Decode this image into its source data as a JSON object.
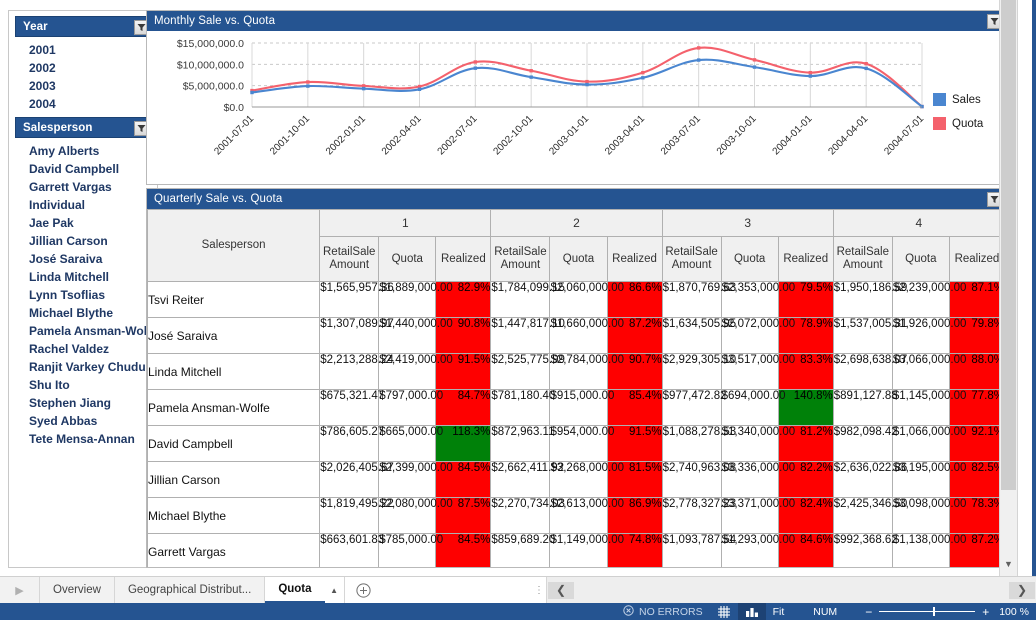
{
  "sidebar": {
    "year_slicer": {
      "title": "Year",
      "filter_icon": "funnel-icon",
      "items": [
        "2001",
        "2002",
        "2003",
        "2004"
      ]
    },
    "salesperson_slicer": {
      "title": "Salesperson",
      "filter_icon": "funnel-icon",
      "items": [
        "Amy Alberts",
        "David Campbell",
        "Garrett Vargas",
        "Individual",
        "Jae Pak",
        "Jillian Carson",
        "José Saraiva",
        "Linda Mitchell",
        "Lynn Tsoflias",
        "Michael Blythe",
        "Pamela Ansman-Wolfe",
        "Rachel Valdez",
        "Ranjit Varkey Chudukatil",
        "Shu Ito",
        "Stephen Jiang",
        "Syed Abbas",
        "Tete Mensa-Annan"
      ]
    }
  },
  "chart_panel": {
    "title": "Monthly Sale vs. Quota",
    "filter_icon": "funnel-icon"
  },
  "chart_data": {
    "type": "line",
    "title": "Monthly Sale vs. Quota",
    "xlabel": "",
    "ylabel": "",
    "ylim": [
      0,
      15000000
    ],
    "grid": true,
    "legend_position": "right",
    "ytick_labels": [
      "$15,000,000.0",
      "$10,000,000.0",
      "$5,000,000.0",
      "$0.0"
    ],
    "ytick_values": [
      15000000,
      10000000,
      5000000,
      0
    ],
    "categories": [
      "2001-07-01",
      "2001-10-01",
      "2002-01-01",
      "2002-04-01",
      "2002-07-01",
      "2002-10-01",
      "2003-01-01",
      "2003-04-01",
      "2003-07-01",
      "2003-10-01",
      "2004-01-01",
      "2004-04-01",
      "2004-07-01"
    ],
    "series": [
      {
        "name": "Sales",
        "color": "#4a86d0",
        "values": [
          3400000,
          4900000,
          4300000,
          4150000,
          9100000,
          7000000,
          5250000,
          6850000,
          11000000,
          9350000,
          7250000,
          9050000,
          100000
        ]
      },
      {
        "name": "Quota",
        "color": "#f4616c",
        "values": [
          3850000,
          5850000,
          4950000,
          4800000,
          10550000,
          8500000,
          5950000,
          8050000,
          13850000,
          11050000,
          8050000,
          10150000,
          100000
        ]
      }
    ]
  },
  "table_panel": {
    "title": "Quarterly Sale vs. Quota",
    "filter_icon": "funnel-icon",
    "row_header": "Salesperson",
    "quarters": [
      "1",
      "2",
      "3",
      "4"
    ],
    "sub_headers": [
      "RetailSale Amount",
      "Quota",
      "Realized"
    ],
    "sub_header_lines": [
      [
        "RetailSale",
        "Amount"
      ],
      [
        "Quota",
        ""
      ],
      [
        "Realized",
        ""
      ]
    ],
    "colors": {
      "bad": "#fe0000",
      "good": "#008109"
    },
    "rows": [
      {
        "name": "Tsvi Reiter",
        "cells": [
          {
            "amount": "$1,565,957.36",
            "quota": "$1,889,000.00",
            "realized": "82.9%",
            "state": "bad"
          },
          {
            "amount": "$1,784,099.15",
            "quota": "$2,060,000.00",
            "realized": "86.6%",
            "state": "bad"
          },
          {
            "amount": "$1,870,769.63",
            "quota": "$2,353,000.00",
            "realized": "79.5%",
            "state": "bad"
          },
          {
            "amount": "$1,950,186.59",
            "quota": "$2,239,000.00",
            "realized": "87.1%",
            "state": "bad"
          }
        ]
      },
      {
        "name": "José Saraiva",
        "cells": [
          {
            "amount": "$1,307,089.97",
            "quota": "$1,440,000.00",
            "realized": "90.8%",
            "state": "bad"
          },
          {
            "amount": "$1,447,817.10",
            "quota": "$1,660,000.00",
            "realized": "87.2%",
            "state": "bad"
          },
          {
            "amount": "$1,634,505.95",
            "quota": "$2,072,000.00",
            "realized": "78.9%",
            "state": "bad"
          },
          {
            "amount": "$1,537,005.31",
            "quota": "$1,926,000.00",
            "realized": "79.8%",
            "state": "bad"
          }
        ]
      },
      {
        "name": "Linda Mitchell",
        "cells": [
          {
            "amount": "$2,213,288.24",
            "quota": "$2,419,000.00",
            "realized": "91.5%",
            "state": "bad"
          },
          {
            "amount": "$2,525,775.99",
            "quota": "$2,784,000.00",
            "realized": "90.7%",
            "state": "bad"
          },
          {
            "amount": "$2,929,305.10",
            "quota": "$3,517,000.00",
            "realized": "83.3%",
            "state": "bad"
          },
          {
            "amount": "$2,698,638.07",
            "quota": "$3,066,000.00",
            "realized": "88.0%",
            "state": "bad"
          }
        ]
      },
      {
        "name": "Pamela Ansman-Wolfe",
        "cells": [
          {
            "amount": "$675,321.47",
            "quota": "$797,000.00",
            "realized": "84.7%",
            "state": "bad"
          },
          {
            "amount": "$781,180.40",
            "quota": "$915,000.00",
            "realized": "85.4%",
            "state": "bad"
          },
          {
            "amount": "$977,472.82",
            "quota": "$694,000.00",
            "realized": "140.8%",
            "state": "good"
          },
          {
            "amount": "$891,127.88",
            "quota": "$1,145,000.00",
            "realized": "77.8%",
            "state": "bad"
          }
        ]
      },
      {
        "name": "David Campbell",
        "cells": [
          {
            "amount": "$786,605.27",
            "quota": "$665,000.00",
            "realized": "118.3%",
            "state": "good"
          },
          {
            "amount": "$872,963.11",
            "quota": "$954,000.00",
            "realized": "91.5%",
            "state": "bad"
          },
          {
            "amount": "$1,088,278.53",
            "quota": "$1,340,000.00",
            "realized": "81.2%",
            "state": "bad"
          },
          {
            "amount": "$982,098.42",
            "quota": "$1,066,000.00",
            "realized": "92.1%",
            "state": "bad"
          }
        ]
      },
      {
        "name": "Jillian Carson",
        "cells": [
          {
            "amount": "$2,026,405.67",
            "quota": "$2,399,000.00",
            "realized": "84.5%",
            "state": "bad"
          },
          {
            "amount": "$2,662,411.92",
            "quota": "$3,268,000.00",
            "realized": "81.5%",
            "state": "bad"
          },
          {
            "amount": "$2,740,963.08",
            "quota": "$3,336,000.00",
            "realized": "82.2%",
            "state": "bad"
          },
          {
            "amount": "$2,636,022.86",
            "quota": "$3,195,000.00",
            "realized": "82.5%",
            "state": "bad"
          }
        ]
      },
      {
        "name": "Michael Blythe",
        "cells": [
          {
            "amount": "$1,819,495.22",
            "quota": "$2,080,000.00",
            "realized": "87.5%",
            "state": "bad"
          },
          {
            "amount": "$2,270,734.03",
            "quota": "$2,613,000.00",
            "realized": "86.9%",
            "state": "bad"
          },
          {
            "amount": "$2,778,327.23",
            "quota": "$3,371,000.00",
            "realized": "82.4%",
            "state": "bad"
          },
          {
            "amount": "$2,425,346.50",
            "quota": "$3,098,000.00",
            "realized": "78.3%",
            "state": "bad"
          }
        ]
      },
      {
        "name": "Garrett Vargas",
        "cells": [
          {
            "amount": "$663,601.83",
            "quota": "$785,000.00",
            "realized": "84.5%",
            "state": "bad"
          },
          {
            "amount": "$859,689.20",
            "quota": "$1,149,000.00",
            "realized": "74.8%",
            "state": "bad"
          },
          {
            "amount": "$1,093,787.54",
            "quota": "$1,293,000.00",
            "realized": "84.6%",
            "state": "bad"
          },
          {
            "amount": "$992,368.62",
            "quota": "$1,138,000.00",
            "realized": "87.2%",
            "state": "bad"
          }
        ]
      }
    ]
  },
  "tabstrip": {
    "nav_icon": "chevron-right-icon",
    "tabs": [
      {
        "label": "Overview",
        "active": false
      },
      {
        "label": "Geographical Distribut...",
        "active": false
      },
      {
        "label": "Quota",
        "active": true
      }
    ],
    "tab_caret_icon": "caret-up-icon",
    "add_sheet_icon": "plus-circle-icon",
    "grip_icon": "vertical-dots-icon",
    "scroll_left_icon": "chevron-left-icon",
    "scroll_right_icon": "chevron-right-icon"
  },
  "statusbar": {
    "errors_icon": "error-circle-icon",
    "errors_label": "NO ERRORS",
    "grid_icon": "grid-view-icon",
    "chart_icon": "chart-view-icon",
    "fit_label": "Fit",
    "num_label": "NUM",
    "zoom_out_icon": "minus-icon",
    "zoom_in_icon": "plus-icon",
    "zoom_level": "100 %"
  }
}
